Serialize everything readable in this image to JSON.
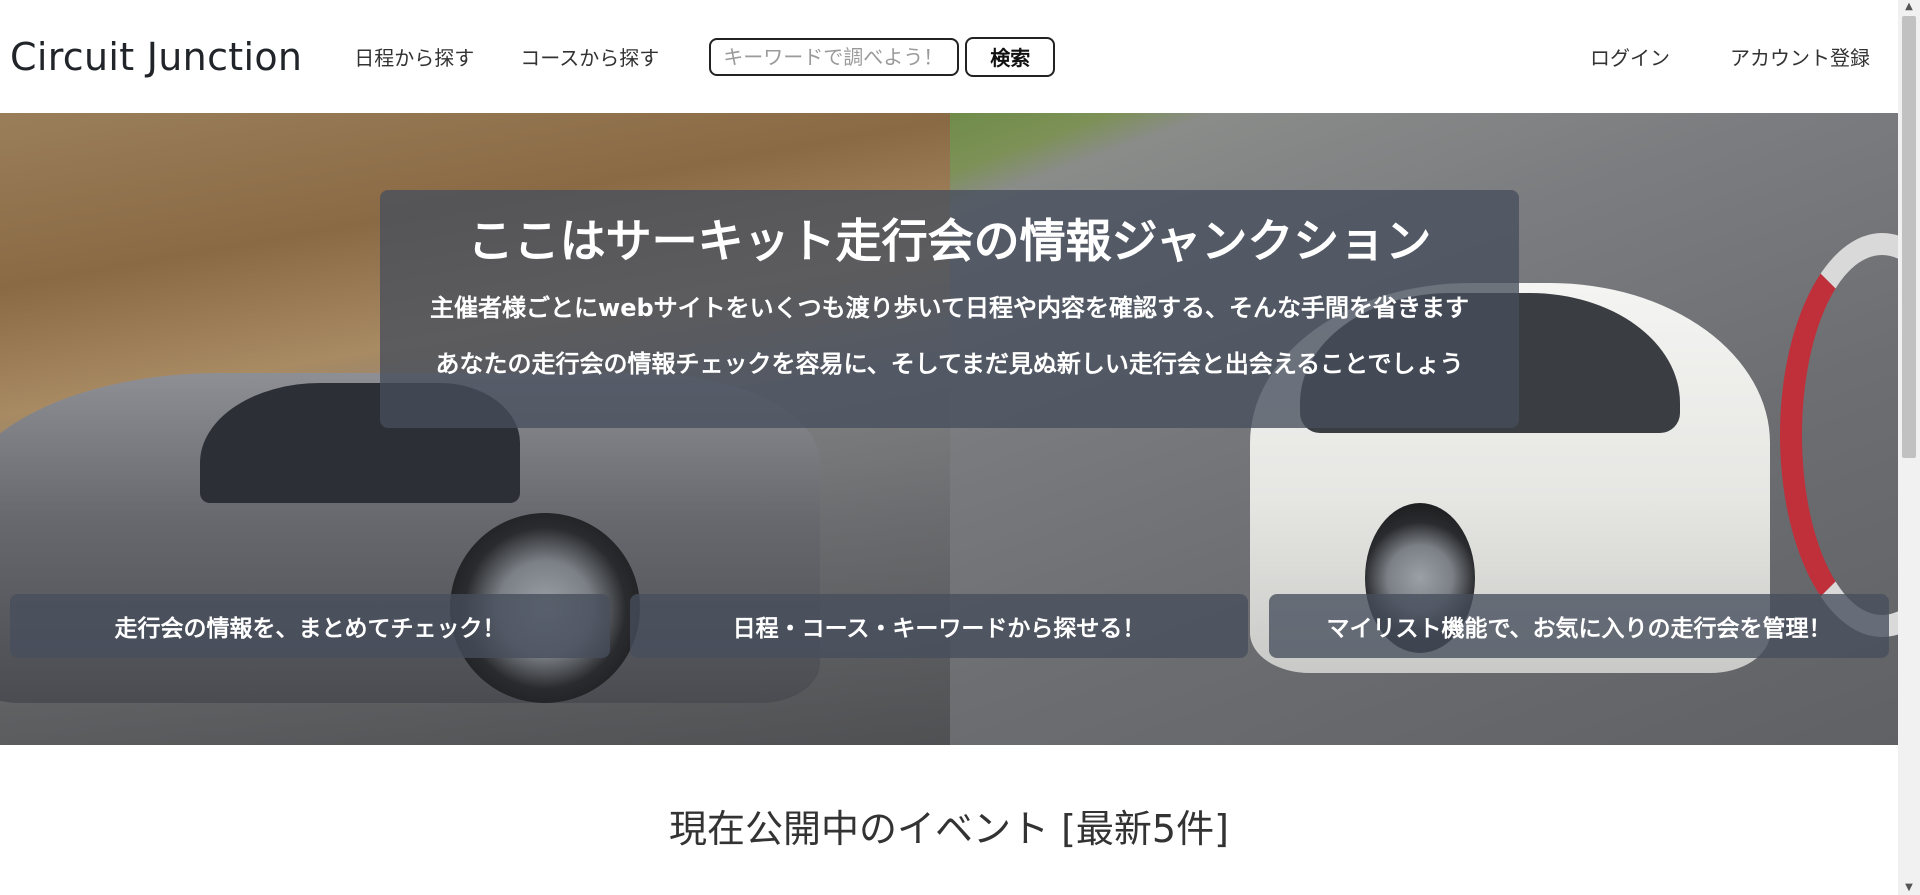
{
  "navbar": {
    "brand": "Circuit Junction",
    "links": [
      "日程から探す",
      "コースから探す"
    ],
    "search": {
      "placeholder": "キーワードで調べよう！",
      "value": "",
      "button_label": "検索"
    },
    "auth": {
      "login": "ログイン",
      "register": "アカウント登録"
    }
  },
  "hero": {
    "title": "ここはサーキット走行会の情報ジャンクション",
    "lines": [
      "主催者様ごとにwebサイトをいくつも渡り歩いて日程や内容を確認する、そんな手間を省きます",
      "あなたの走行会の情報チェックを容易に、そしてまだ見ぬ新しい走行会と出会えることでしょう"
    ],
    "features": [
      "走行会の情報を、まとめてチェック！",
      "日程・コース・キーワードから探せる！",
      "マイリスト機能で、お気に入りの走行会を管理！"
    ]
  },
  "main": {
    "section_title": "現在公開中のイベント [最新5件]"
  }
}
